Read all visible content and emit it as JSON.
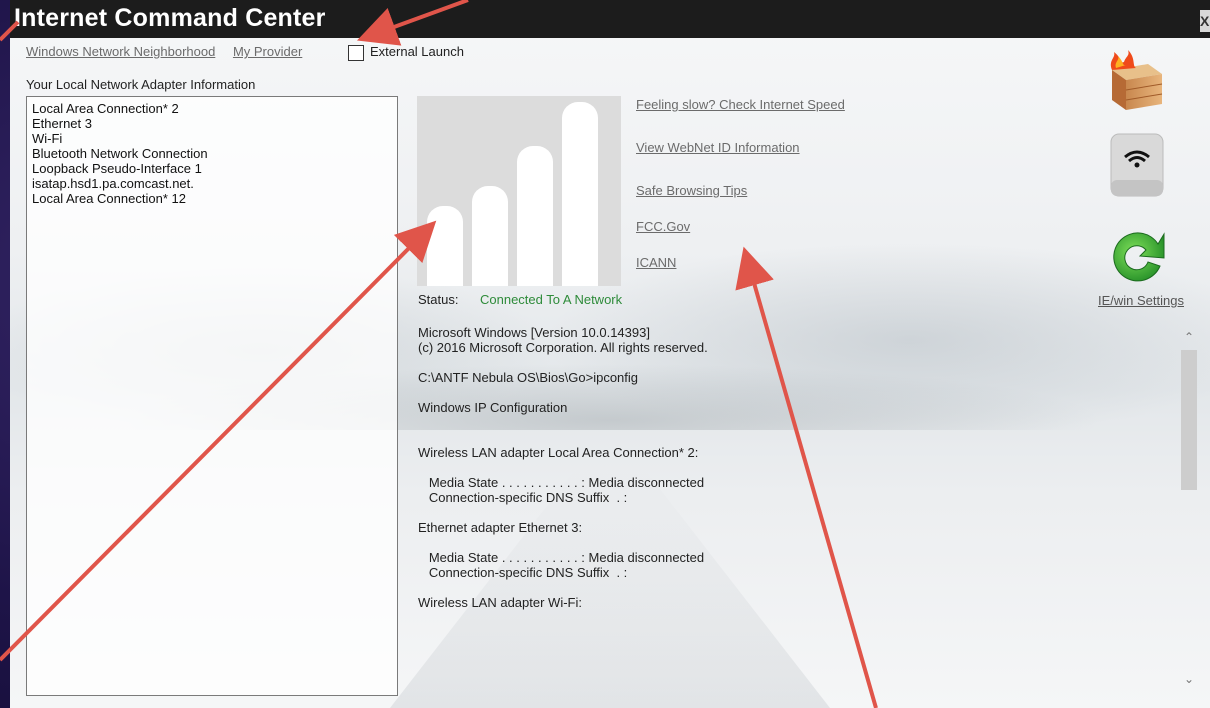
{
  "window": {
    "title": "Internet Command Center",
    "close_label": "X"
  },
  "toolbar": {
    "link_network": "Windows Network Neighborhood",
    "link_provider": "My Provider",
    "external_launch_label": "External Launch",
    "external_launch_checked": false
  },
  "adapters": {
    "heading": "Your Local Network Adapter Information",
    "items": [
      "Local Area Connection* 2",
      "Ethernet 3",
      "Wi-Fi",
      "Bluetooth Network Connection",
      "Loopback Pseudo-Interface 1",
      "isatap.hsd1.pa.comcast.net.",
      "Local Area Connection* 12"
    ]
  },
  "links": {
    "speed": "Feeling slow? Check Internet Speed",
    "webnet": "View WebNet ID Information",
    "safe": "Safe Browsing Tips",
    "fcc": "FCC.Gov",
    "icann": "ICANN"
  },
  "status": {
    "label": "Status:",
    "value": "Connected To A Network",
    "color": "#2e8b3a"
  },
  "console": {
    "lines": [
      "Microsoft Windows [Version 10.0.14393]",
      "(c) 2016 Microsoft Corporation. All rights reserved.",
      "",
      "C:\\ANTF Nebula OS\\Bios\\Go>ipconfig",
      "",
      "Windows IP Configuration",
      "",
      "",
      "Wireless LAN adapter Local Area Connection* 2:",
      "",
      "   Media State . . . . . . . . . . . : Media disconnected",
      "   Connection-specific DNS Suffix  . :",
      "",
      "Ethernet adapter Ethernet 3:",
      "",
      "   Media State . . . . . . . . . . . : Media disconnected",
      "   Connection-specific DNS Suffix  . :",
      "",
      "Wireless LAN adapter Wi-Fi:"
    ]
  },
  "side": {
    "firewall_icon": "firewall-icon",
    "wifi_icon": "wifi-drive-icon",
    "refresh_icon": "refresh-icon",
    "settings_label": "IE/win Settings"
  },
  "colors": {
    "titlebar": "#1c1c1c",
    "arrows": "#e0554a",
    "background": "#1e1448"
  }
}
